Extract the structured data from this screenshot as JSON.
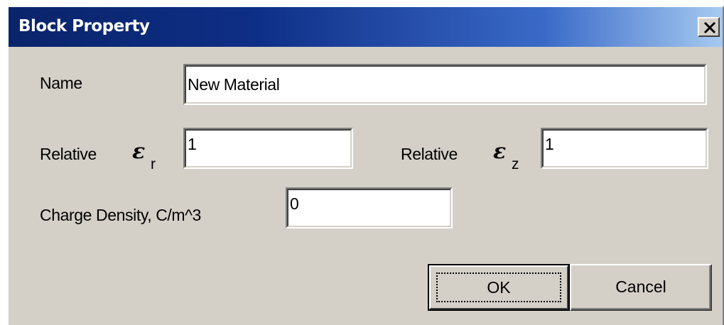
{
  "window": {
    "title": "Block Property"
  },
  "icons": {
    "close": "close-x-icon"
  },
  "form": {
    "name_label": "Name",
    "name_value": "New Material",
    "er_label": "Relative",
    "er_symbol": "ε",
    "er_subscript": "r",
    "er_value": "1",
    "ez_label": "Relative",
    "ez_symbol": "ε",
    "ez_subscript": "z",
    "ez_value": "1",
    "charge_label": "Charge Density, C/m^3",
    "charge_value": "0"
  },
  "buttons": {
    "ok_label": "OK",
    "cancel_label": "Cancel"
  },
  "colors": {
    "title_bar_start": "#0a246a",
    "title_bar_end": "#a6caf0",
    "dialog_face": "#d4d0c8"
  }
}
